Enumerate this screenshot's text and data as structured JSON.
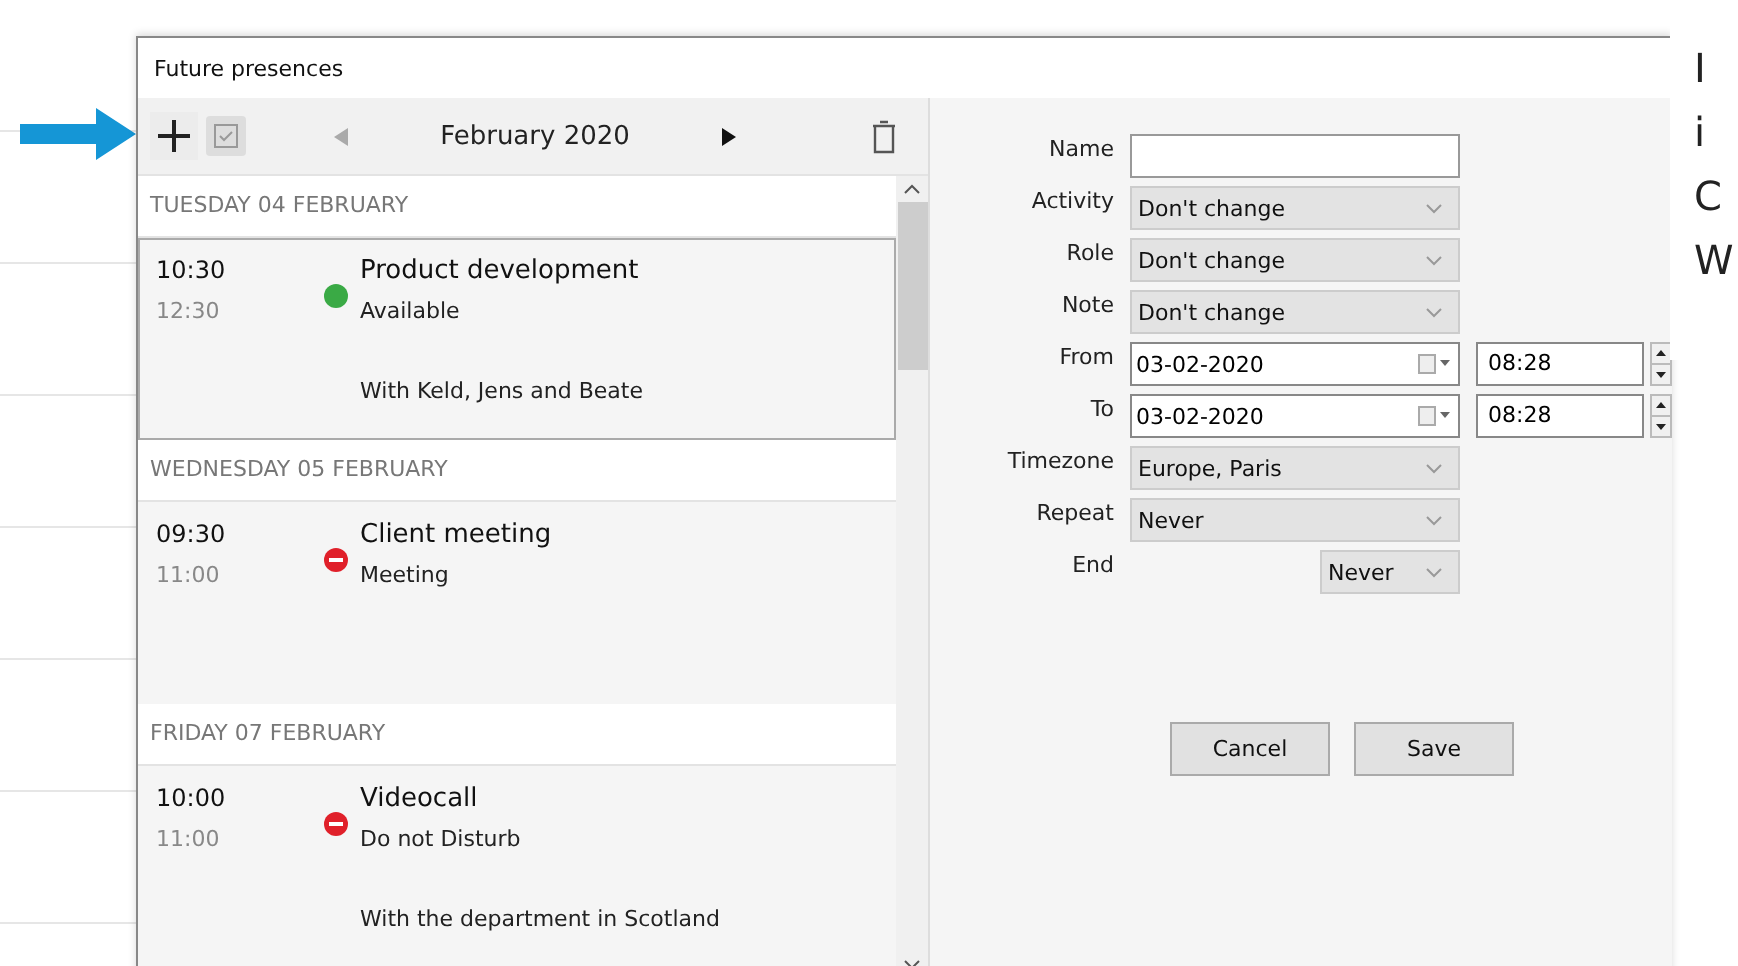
{
  "window": {
    "title": "Future presences"
  },
  "toolbar": {
    "month": "February 2020"
  },
  "days": [
    {
      "label": "TUESDAY 04 FEBRUARY",
      "events": [
        {
          "start": "10:30",
          "end": "12:30",
          "title": "Product development",
          "kind": "available",
          "color": "#3aaa45",
          "activity": "Available",
          "note": "With Keld, Jens and Beate",
          "selected": true
        }
      ]
    },
    {
      "label": "WEDNESDAY 05 FEBRUARY",
      "events": [
        {
          "start": "09:30",
          "end": "11:00",
          "title": "Client meeting",
          "kind": "busy",
          "color": "#e0202a",
          "activity": "Meeting",
          "selected": false
        }
      ]
    },
    {
      "label": "FRIDAY 07 FEBRUARY",
      "events": [
        {
          "start": "10:00",
          "end": "11:00",
          "title": "Videocall",
          "kind": "busy",
          "color": "#e0202a",
          "activity": "Do not Disturb",
          "note": "With the department in Scotland",
          "selected": false
        }
      ]
    }
  ],
  "form": {
    "fields": [
      {
        "label": "Name",
        "kind": "text"
      },
      {
        "label": "Activity",
        "kind": "select",
        "value": "Don't change"
      },
      {
        "label": "Role",
        "kind": "select",
        "value": "Don't change"
      },
      {
        "label": "Note",
        "kind": "select",
        "value": "Don't change"
      },
      {
        "label": "From",
        "kind": "datetime",
        "value": "03-02-2020",
        "time": "08:28"
      },
      {
        "label": "To",
        "kind": "datetime",
        "value": "03-02-2020",
        "time": "08:28"
      },
      {
        "label": "Timezone",
        "kind": "select",
        "value": "Europe, Paris"
      },
      {
        "label": "Repeat",
        "kind": "select",
        "value": "Never"
      },
      {
        "label": "End",
        "kind": "short-select",
        "value": "Never"
      }
    ],
    "buttons": [
      "Cancel",
      "Save"
    ]
  },
  "overlay_text": [
    "I",
    "i",
    "C",
    "W"
  ]
}
